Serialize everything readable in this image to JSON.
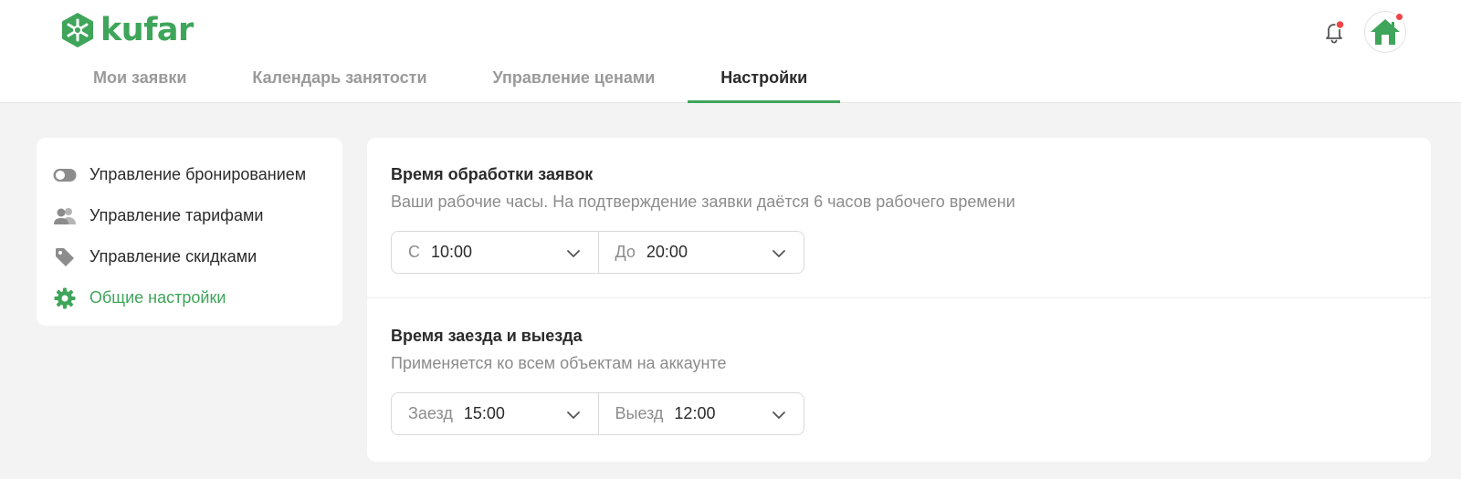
{
  "brand": {
    "name": "kufar",
    "color": "#3ea55a"
  },
  "header": {
    "tabs": [
      {
        "label": "Мои заявки",
        "active": false
      },
      {
        "label": "Календарь занятости",
        "active": false
      },
      {
        "label": "Управление ценами",
        "active": false
      },
      {
        "label": "Настройки",
        "active": true
      }
    ],
    "icons": {
      "notifications": "bell-icon",
      "avatar": "house-icon"
    }
  },
  "sidebar": {
    "items": [
      {
        "label": "Управление бронированием",
        "icon": "toggle-icon",
        "active": false
      },
      {
        "label": "Управление тарифами",
        "icon": "users-icon",
        "active": false
      },
      {
        "label": "Управление скидками",
        "icon": "tag-icon",
        "active": false
      },
      {
        "label": "Общие настройки",
        "icon": "gear-icon",
        "active": true
      }
    ]
  },
  "main": {
    "processing": {
      "title": "Время обработки заявок",
      "description": "Ваши рабочие часы. На подтверждение заявки даётся 6 часов рабочего времени",
      "from_label": "С",
      "from_value": "10:00",
      "to_label": "До",
      "to_value": "20:00"
    },
    "checkin": {
      "title": "Время заезда и выезда",
      "description": "Применяется ко всем объектам на аккаунте",
      "in_label": "Заезд",
      "in_value": "15:00",
      "out_label": "Выезд",
      "out_value": "12:00"
    }
  },
  "colors": {
    "accent": "#3ea55a",
    "badge": "#f04545",
    "muted": "#8c8c8c"
  }
}
